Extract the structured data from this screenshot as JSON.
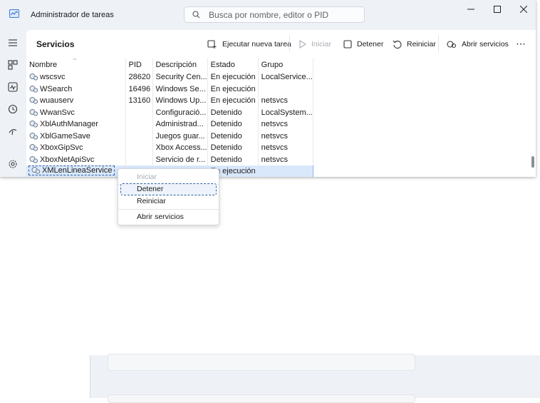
{
  "window": {
    "title": "Administrador de tareas",
    "controls": {
      "minimize": "–",
      "maximize": "☐",
      "close": "✕"
    }
  },
  "search": {
    "placeholder": "Busca por nombre, editor o PID"
  },
  "nav": {
    "items": [
      "hamburger-icon",
      "processes-icon",
      "performance-icon",
      "history-icon",
      "startup-icon",
      "settings-icon"
    ]
  },
  "page": {
    "title": "Servicios",
    "toolbar": {
      "run_task": "Ejecutar nueva tarea",
      "start": "Iniciar",
      "stop": "Detener",
      "restart": "Reiniciar",
      "open_services": "Abrir servicios",
      "more": "···"
    }
  },
  "table": {
    "sort_indicator": "^",
    "headers": {
      "name": "Nombre",
      "pid": "PID",
      "desc": "Descripción",
      "status": "Estado",
      "group": "Grupo"
    },
    "rows": [
      {
        "name": "wscsvc",
        "pid": "28620",
        "desc": "Security Cen...",
        "status": "En ejecución",
        "group": "LocalService..."
      },
      {
        "name": "WSearch",
        "pid": "16496",
        "desc": "Windows Se...",
        "status": "En ejecución",
        "group": ""
      },
      {
        "name": "wuauserv",
        "pid": "13160",
        "desc": "Windows Up...",
        "status": "En ejecución",
        "group": "netsvcs"
      },
      {
        "name": "WwanSvc",
        "pid": "",
        "desc": "Configuració...",
        "status": "Detenido",
        "group": "LocalSystem..."
      },
      {
        "name": "XblAuthManager",
        "pid": "",
        "desc": "Administrad...",
        "status": "Detenido",
        "group": "netsvcs"
      },
      {
        "name": "XblGameSave",
        "pid": "",
        "desc": "Juegos guar...",
        "status": "Detenido",
        "group": "netsvcs"
      },
      {
        "name": "XboxGipSvc",
        "pid": "",
        "desc": "Xbox Access...",
        "status": "Detenido",
        "group": "netsvcs"
      },
      {
        "name": "XboxNetApiSvc",
        "pid": "",
        "desc": "Servicio de r...",
        "status": "Detenido",
        "group": "netsvcs"
      },
      {
        "name": "XMLenLineaService",
        "pid": "",
        "desc": "",
        "status": "En ejecución",
        "group": ""
      }
    ]
  },
  "context_menu": {
    "start": "Iniciar",
    "stop": "Detener",
    "restart": "Reiniciar",
    "open_services": "Abrir servicios"
  },
  "colors": {
    "window_bg": "#eef1f6",
    "selection": "#d9e8fb",
    "focus_outline": "#2d5fa3",
    "disabled_text": "#a9adb3"
  }
}
